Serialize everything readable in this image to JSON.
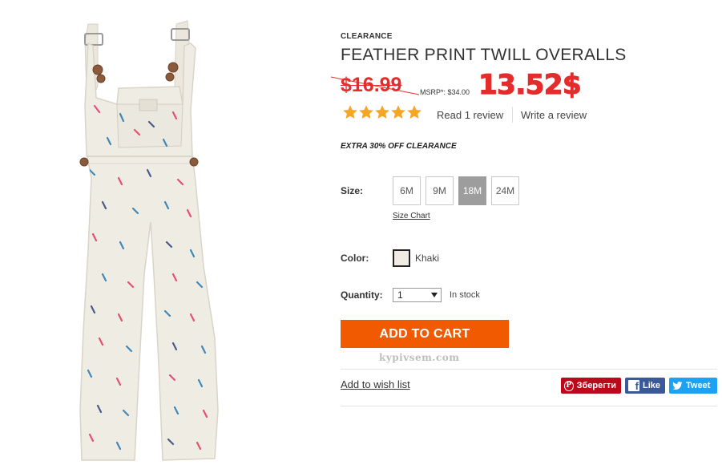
{
  "product": {
    "category": "CLEARANCE",
    "title": "FEATHER PRINT TWILL OVERALLS",
    "old_price": "$16.99",
    "msrp": "MSRP*: $34.00",
    "new_price": "13.52$",
    "rating": 5,
    "rating_max": 5,
    "read_reviews": "Read 1 review",
    "write_review": "Write a review",
    "promo": "EXTRA 30% OFF CLEARANCE"
  },
  "size": {
    "label": "Size:",
    "options": [
      "6M",
      "9M",
      "18M",
      "24M"
    ],
    "selected": "18M",
    "chart_link": "Size Chart"
  },
  "color": {
    "label": "Color:",
    "name": "Khaki",
    "swatch": "#f0ece4"
  },
  "quantity": {
    "label": "Quantity:",
    "value": "1",
    "stock": "In stock"
  },
  "cart": {
    "add_label": "ADD TO CART",
    "button_color": "#f15a00"
  },
  "watermark": "kypivsem.com",
  "wishlist": "Add to wish list",
  "social": {
    "pinterest": "Зберегти",
    "facebook": "Like",
    "twitter": "Tweet"
  },
  "colors": {
    "price_red": "#e42c2c",
    "star": "#f5a623"
  }
}
